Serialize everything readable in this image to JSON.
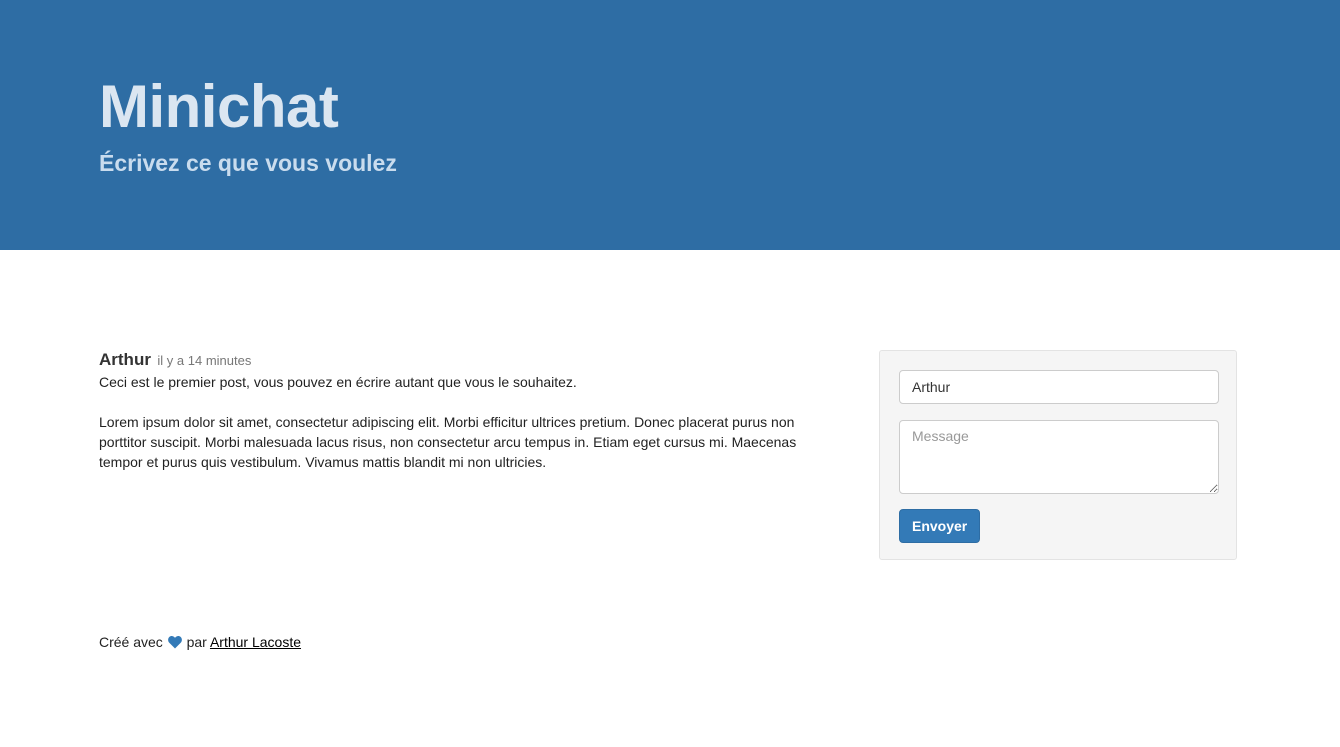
{
  "header": {
    "title": "Minichat",
    "subtitle": "Écrivez ce que vous voulez"
  },
  "post": {
    "author": "Arthur",
    "time": "il y a 14 minutes",
    "paragraphs": [
      "Ceci est le premier post, vous pouvez en écrire autant que vous le souhaitez.",
      "Lorem ipsum dolor sit amet, consectetur adipiscing elit. Morbi efficitur ultrices pretium. Donec placerat purus non porttitor suscipit. Morbi malesuada lacus risus, non consectetur arcu tempus in. Etiam eget cursus mi. Maecenas tempor et purus quis vestibulum. Vivamus mattis blandit mi non ultricies."
    ]
  },
  "form": {
    "name_value": "Arthur",
    "message_placeholder": "Message",
    "submit_label": "Envoyer"
  },
  "footer": {
    "prefix": "Créé avec",
    "middle": "par",
    "author_link": "Arthur Lacoste",
    "heart_icon": "heart-icon"
  },
  "colors": {
    "header_bg": "#2e6da4",
    "button_bg": "#337ab7",
    "heart": "#337ab7"
  }
}
